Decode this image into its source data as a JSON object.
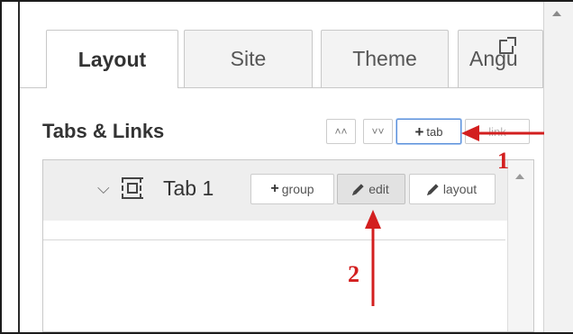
{
  "tabs": [
    {
      "label": "Layout",
      "active": true
    },
    {
      "label": "Site",
      "active": false
    },
    {
      "label": "Theme",
      "active": false
    },
    {
      "label": "Angu",
      "active": false
    }
  ],
  "section": {
    "heading": "Tabs & Links"
  },
  "toolbar": {
    "collapse_label": "˄",
    "expand_label": "˅",
    "add_tab_label": "tab",
    "add_link_label": "link"
  },
  "tree": {
    "rows": [
      {
        "name": "Tab 1",
        "group_label": "group",
        "edit_label": "edit",
        "layout_label": "layout"
      }
    ]
  },
  "annotations": [
    {
      "number": "1",
      "color": "#d31f1f"
    },
    {
      "number": "2",
      "color": "#d31f1f"
    }
  ],
  "icons": {
    "expand_chevron": "chevron-down-icon",
    "tab_type": "tab-frame-icon",
    "external_link": "external-link-icon",
    "pencil": "pencil-icon",
    "plus": "plus-icon"
  }
}
